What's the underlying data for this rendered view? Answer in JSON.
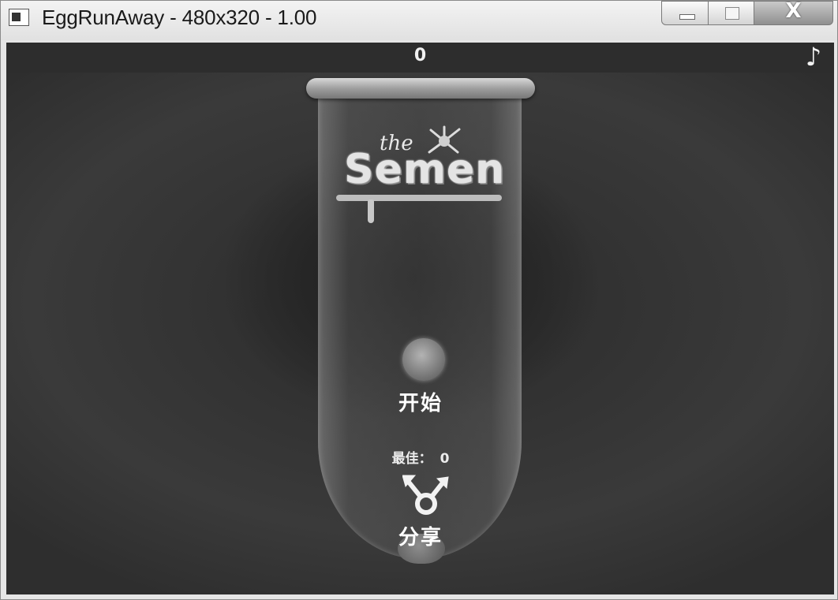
{
  "window": {
    "title": "EggRunAway - 480x320 - 1.00",
    "close_glyph": "X"
  },
  "hud": {
    "score": "0",
    "music_glyph": "♪"
  },
  "menu": {
    "logo_the": "the",
    "logo_main": "Semen",
    "start_label": "开始",
    "best_label": "最佳：",
    "best_value": "0",
    "share_label": "分享"
  }
}
